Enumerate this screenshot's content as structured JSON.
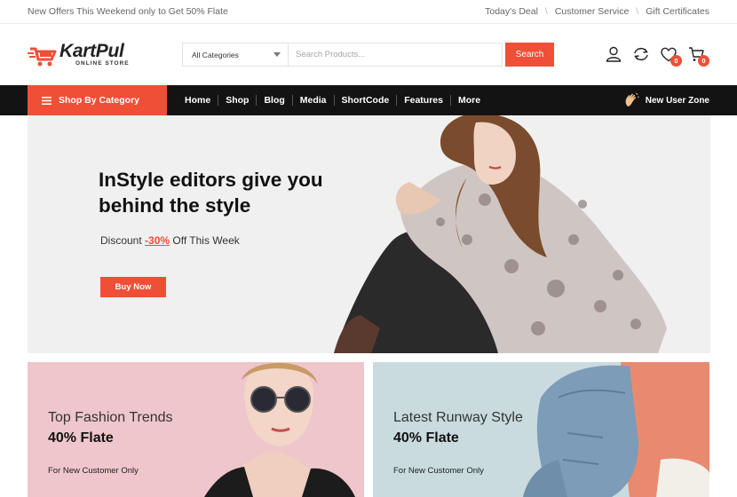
{
  "topbar": {
    "offer_text": "New Offers This Weekend only to Get 50% Flate",
    "links": [
      "Today's Deal",
      "Customer Service",
      "Gift Certificates"
    ],
    "separator": "\\"
  },
  "logo": {
    "brand": "KartPul",
    "tagline": "ONLINE STORE"
  },
  "search": {
    "category": "All Categories",
    "placeholder": "Search Products...",
    "button": "Search"
  },
  "header_icons": {
    "wishlist_count": "0",
    "cart_count": "0"
  },
  "nav": {
    "shop_by_category": "Shop By Category",
    "items": [
      "Home",
      "Shop",
      "Blog",
      "Media",
      "ShortCode",
      "Features",
      "More"
    ],
    "user_zone": "New User Zone"
  },
  "hero": {
    "title_line1": "InStyle editors give you",
    "title_line2": "behind the style",
    "sub_prefix": "Discount ",
    "sub_discount": "-30%",
    "sub_suffix": " Off This Week",
    "button": "Buy Now"
  },
  "promos": [
    {
      "title": "Top Fashion Trends",
      "offer": "40% Flate",
      "note": "For New Customer Only"
    },
    {
      "title": "Latest Runway Style",
      "offer": "40% Flate",
      "note": "For New Customer Only"
    }
  ],
  "colors": {
    "accent": "#ee4f36",
    "nav_bg": "#131313",
    "promo_pink": "#efc6cb",
    "promo_blue": "#c9dbdf"
  }
}
